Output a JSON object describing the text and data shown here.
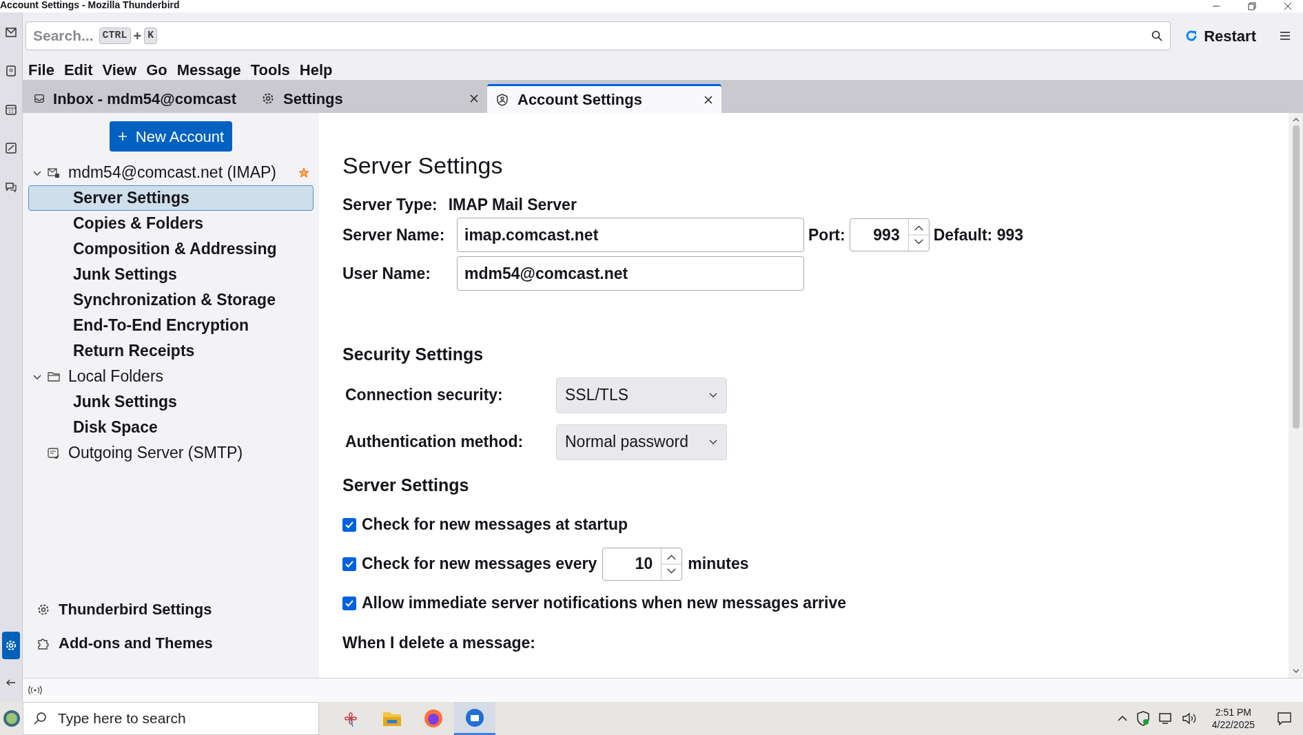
{
  "window": {
    "title": "Account Settings - Mozilla Thunderbird"
  },
  "search": {
    "placeholder": "Search...",
    "shortcut": [
      "CTRL",
      "+",
      "K"
    ]
  },
  "restart_button": "Restart",
  "menu": [
    "File",
    "Edit",
    "View",
    "Go",
    "Message",
    "Tools",
    "Help"
  ],
  "tabs": [
    {
      "label": "Inbox - mdm54@comcast",
      "kind": "inbox",
      "selected": false,
      "closable": false
    },
    {
      "label": "Settings",
      "kind": "settings",
      "selected": false,
      "closable": true
    },
    {
      "label": "Account Settings",
      "kind": "account",
      "selected": true,
      "closable": true
    }
  ],
  "sidebar": {
    "new_account_button": "New Account",
    "accounts": [
      {
        "label": "mdm54@comcast.net (IMAP)",
        "kind": "imap",
        "expanded": true,
        "default": true,
        "children": [
          {
            "label": "Server Settings",
            "selected": true
          },
          {
            "label": "Copies & Folders",
            "selected": false
          },
          {
            "label": "Composition & Addressing",
            "selected": false
          },
          {
            "label": "Junk Settings",
            "selected": false
          },
          {
            "label": "Synchronization & Storage",
            "selected": false
          },
          {
            "label": "End-To-End Encryption",
            "selected": false
          },
          {
            "label": "Return Receipts",
            "selected": false
          }
        ]
      },
      {
        "label": "Local Folders",
        "kind": "local",
        "expanded": true,
        "default": false,
        "children": [
          {
            "label": "Junk Settings",
            "selected": false
          },
          {
            "label": "Disk Space",
            "selected": false
          }
        ]
      },
      {
        "label": "Outgoing Server (SMTP)",
        "kind": "smtp",
        "default": false
      }
    ],
    "links": [
      {
        "label": "Thunderbird Settings",
        "kind": "gear"
      },
      {
        "label": "Add-ons and Themes",
        "kind": "puzzle"
      }
    ]
  },
  "content": {
    "heading": "Server Settings",
    "server_type": {
      "label": "Server Type:",
      "value": "IMAP Mail Server"
    },
    "server_name": {
      "label": "Server Name:",
      "value": "imap.comcast.net"
    },
    "port": {
      "label": "Port:",
      "value": "993",
      "default": "Default: 993"
    },
    "user_name": {
      "label": "User Name:",
      "value": "mdm54@comcast.net"
    },
    "security_heading": "Security Settings",
    "selects": [
      {
        "label": "Connection security:",
        "value": "SSL/TLS"
      },
      {
        "label": "Authentication method:",
        "value": "Normal password"
      }
    ],
    "server_heading": "Server Settings",
    "options": [
      {
        "kind": "checkbox",
        "label": "Check for new messages at startup",
        "checked": true
      },
      {
        "kind": "interval",
        "label": "Check for new messages every",
        "checked": true,
        "value": "10",
        "unit": "minutes"
      },
      {
        "kind": "checkbox",
        "label": "Allow immediate server notifications when new messages arrive",
        "checked": true
      }
    ],
    "delete_heading": "When I delete a message:"
  },
  "taskbar": {
    "search_placeholder": "Type here to search",
    "time": "2:51 PM",
    "date": "4/22/2025"
  }
}
